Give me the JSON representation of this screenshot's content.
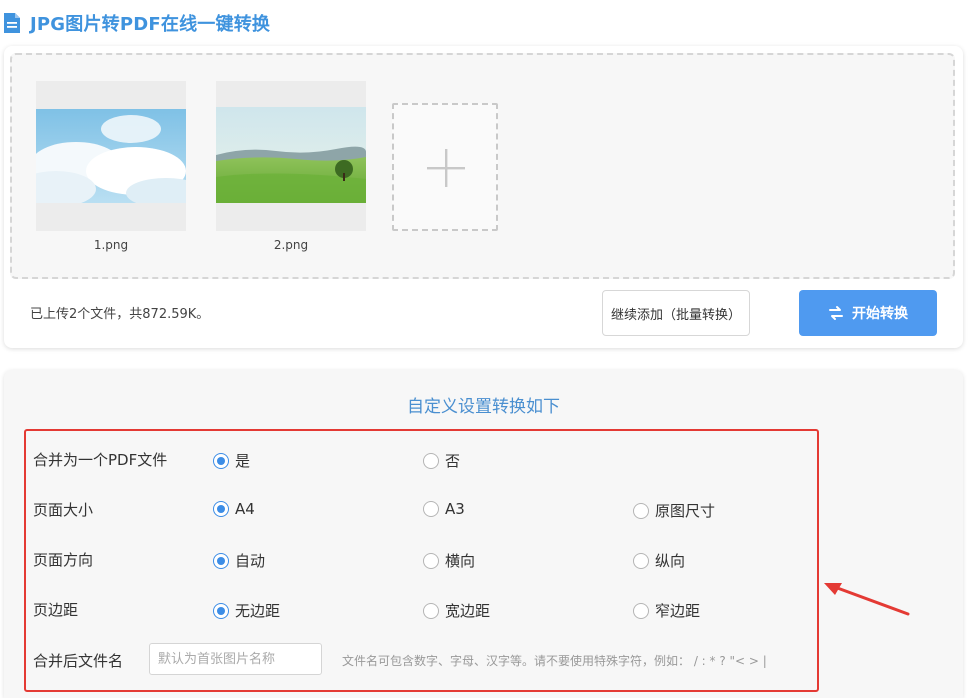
{
  "page_title": "JPG图片转PDF在线一键转换",
  "files": [
    {
      "name": "1.png"
    },
    {
      "name": "2.png"
    }
  ],
  "upload_info": "已上传2个文件，共872.59K。",
  "buttons": {
    "continue": "继续添加（批量转换）",
    "start": "开始转换"
  },
  "settings": {
    "heading": "自定义设置转换如下",
    "merge": {
      "label": "合并为一个PDF文件",
      "options": [
        "是",
        "否"
      ],
      "selected": "是"
    },
    "page_size": {
      "label": "页面大小",
      "options": [
        "A4",
        "A3",
        "原图尺寸"
      ],
      "selected": "A4"
    },
    "orientation": {
      "label": "页面方向",
      "options": [
        "自动",
        "横向",
        "纵向"
      ],
      "selected": "自动"
    },
    "margin": {
      "label": "页边距",
      "options": [
        "无边距",
        "宽边距",
        "窄边距"
      ],
      "selected": "无边距"
    },
    "filename": {
      "label": "合并后文件名",
      "placeholder": "默认为首张图片名称",
      "value": "",
      "hint": "文件名可包含数字、字母、汉字等。请不要使用特殊字符，例如：  / : * ? \"< > |"
    }
  },
  "colors": {
    "accent": "#3f93de",
    "primary_button": "#4f9af0",
    "highlight": "#e43a34"
  },
  "icons": [
    "document-icon",
    "plus-icon",
    "swap-icon",
    "annotation-arrow"
  ]
}
